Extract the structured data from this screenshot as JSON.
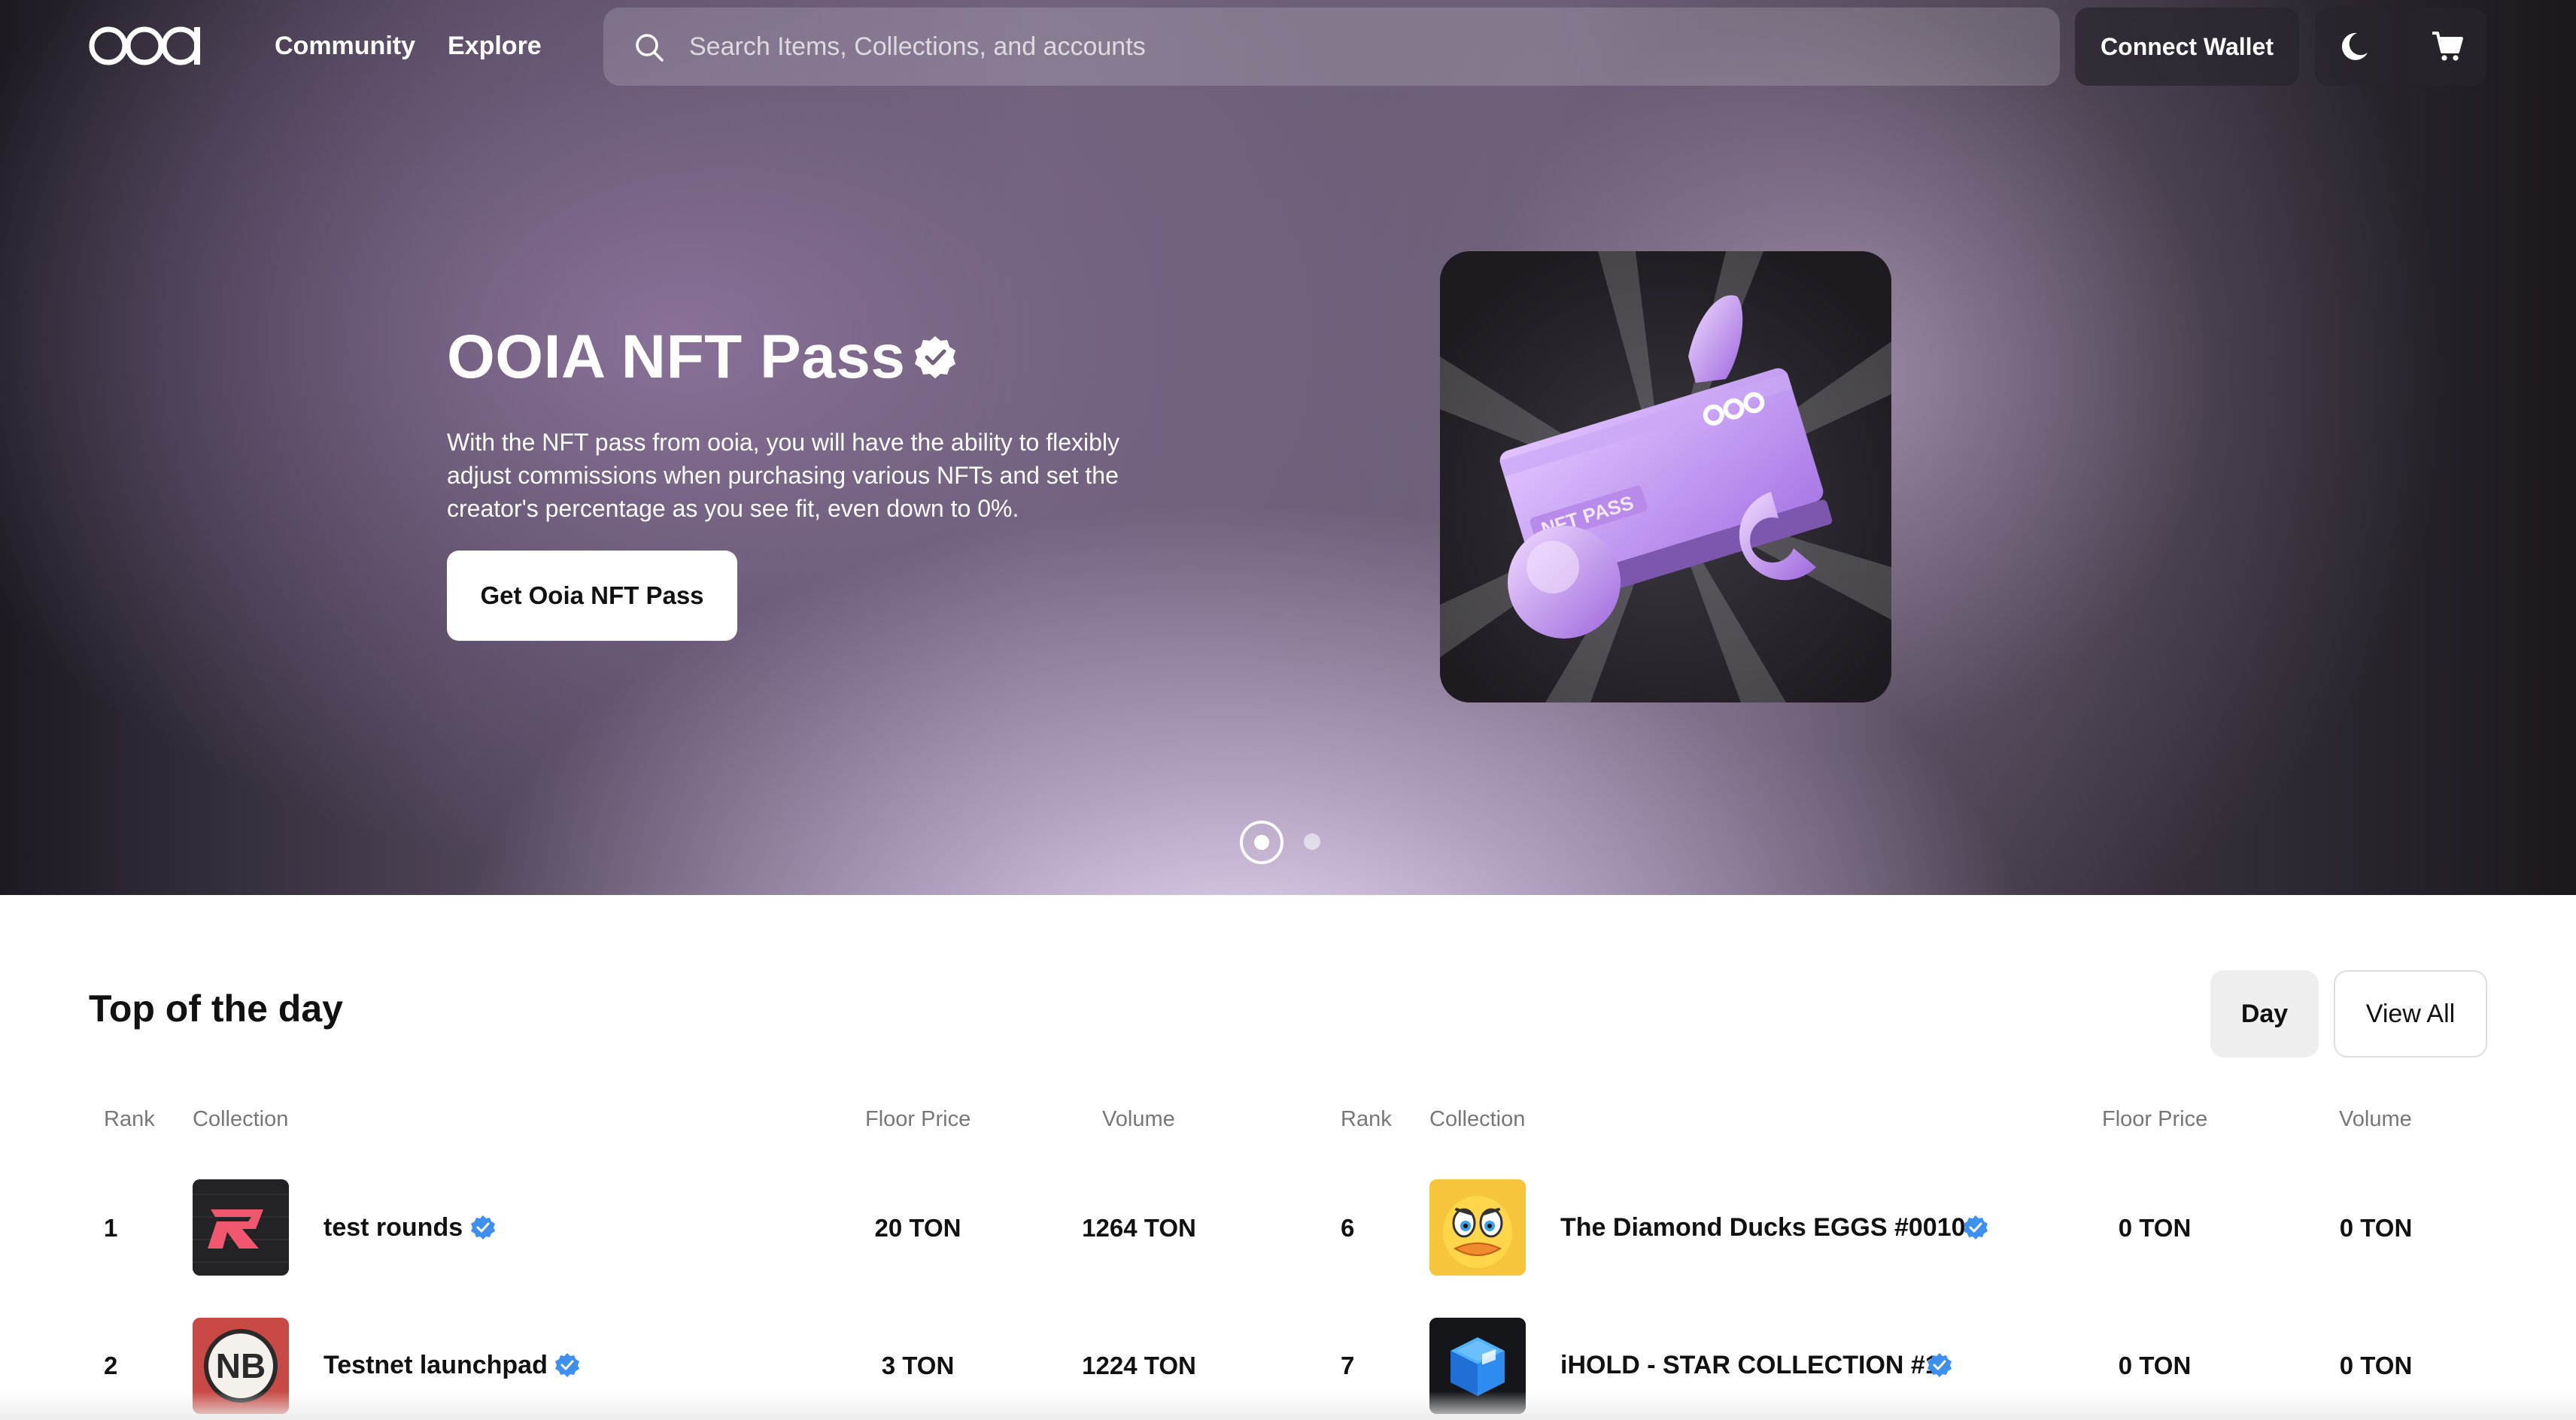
{
  "header": {
    "logo_text": "ooa",
    "nav": [
      "Community",
      "Explore"
    ],
    "search_placeholder": "Search Items, Collections, and accounts",
    "connect_wallet": "Connect Wallet",
    "theme_icon": "moon-icon",
    "cart_icon": "cart-icon"
  },
  "hero": {
    "title": "OOIA NFT Pass",
    "description": "With the NFT pass from ooia, you will have the ability to flexibly adjust commissions when purchasing various NFTs and set the creator's percentage as you see fit, even down to 0%.",
    "cta": "Get Ooia NFT Pass",
    "card_text_logo": "ooa",
    "card_text_pass": "NFT PASS",
    "slides_total": 2,
    "active_slide": 1
  },
  "top": {
    "title": "Top of the day",
    "period_button": "Day",
    "view_all": "View All",
    "columns": [
      "Rank",
      "Collection",
      "Floor Price",
      "Volume"
    ],
    "rows": [
      {
        "rank": "1",
        "name": "test rounds",
        "floor": "20 TON",
        "volume": "1264 TON",
        "verified": true
      },
      {
        "rank": "2",
        "name": "Testnet launchpad",
        "floor": "3 TON",
        "volume": "1224 TON",
        "verified": true
      },
      {
        "rank": "6",
        "name": "The Diamond Ducks EGGS #0010",
        "floor": "0 TON",
        "volume": "0 TON",
        "verified": true
      },
      {
        "rank": "7",
        "name": "iHOLD - STAR COLLECTION #1",
        "floor": "0 TON",
        "volume": "0 TON",
        "verified": true
      }
    ],
    "thumb2_text": "NB"
  },
  "colors": {
    "accent_verified": "#3d8ff0",
    "cta_bg": "#ffffff",
    "day_bg": "#eeeeee"
  }
}
